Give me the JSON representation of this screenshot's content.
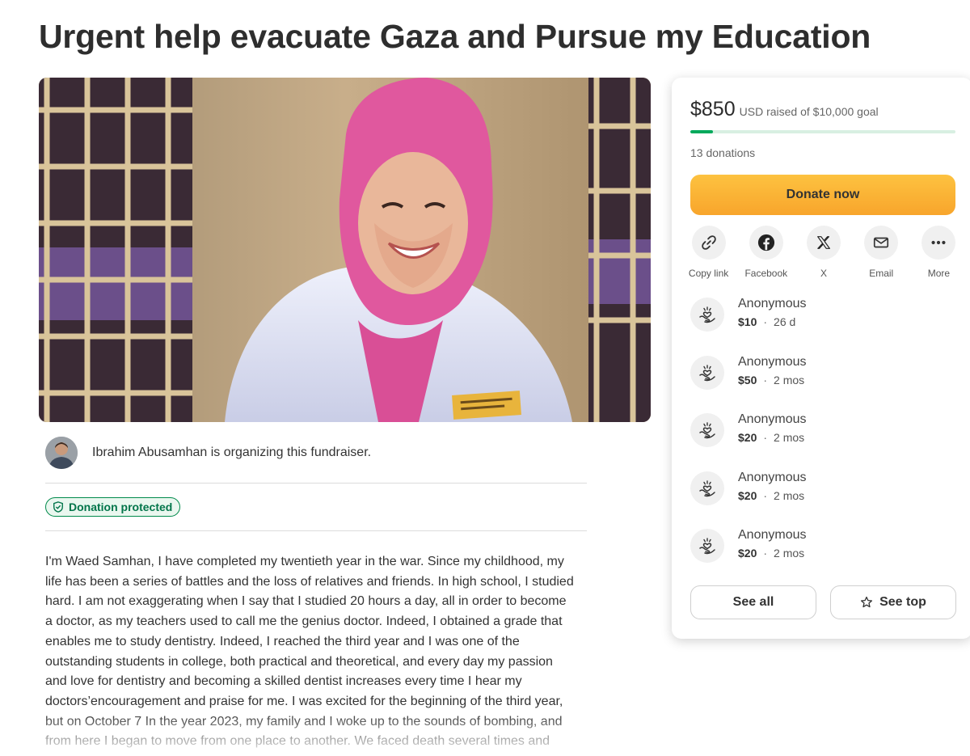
{
  "page": {
    "title": "Urgent help evacuate Gaza and Pursue my Education"
  },
  "organizer": {
    "text": "Ibrahim Abusamhan is organizing this fundraiser."
  },
  "badge": {
    "label": "Donation protected",
    "color": "#008a4b"
  },
  "story": {
    "lines": [
      "I'm Waed Samhan, I have completed my twentieth year in the war. Since my childhood, my",
      "life has been a series of battles and the loss of relatives and friends. In high school, I studied",
      "hard. I am not exaggerating when I say that I studied 20 hours a day, all in order to become",
      "a doctor, as my teachers used to call me the genius doctor. Indeed, I obtained a grade that",
      "enables me to study dentistry. Indeed, I reached the third year and I was one of the",
      "outstanding students in college, both practical and theoretical, and every day my passion",
      "and love for dentistry and becoming a skilled dentist increases every time I hear my",
      "doctors’encouragement and praise for me. I was excited for the beginning of the third year,",
      "but on October 7 In the year 2023, my family and I woke up to the sounds of bombing, and",
      "from here I began to move from one place to another. We faced death several times and"
    ]
  },
  "fundraiser": {
    "raised": "$850",
    "goal_text": "USD raised of $10,000 goal",
    "progress_fraction": 0.085,
    "donation_count": "13 donations",
    "donate_label": "Donate now",
    "accent_color": "#02a95c",
    "donate_color": "#fbb437"
  },
  "share": [
    {
      "label": "Copy link",
      "icon": "link-icon"
    },
    {
      "label": "Facebook",
      "icon": "facebook-icon"
    },
    {
      "label": "X",
      "icon": "x-icon"
    },
    {
      "label": "Email",
      "icon": "email-icon"
    },
    {
      "label": "More",
      "icon": "more-icon"
    }
  ],
  "donations": [
    {
      "name": "Anonymous",
      "amount": "$10",
      "time": "26 d"
    },
    {
      "name": "Anonymous",
      "amount": "$50",
      "time": "2 mos"
    },
    {
      "name": "Anonymous",
      "amount": "$20",
      "time": "2 mos"
    },
    {
      "name": "Anonymous",
      "amount": "$20",
      "time": "2 mos"
    },
    {
      "name": "Anonymous",
      "amount": "$20",
      "time": "2 mos"
    }
  ],
  "buttons": {
    "see_all": "See all",
    "see_top": "See top"
  }
}
